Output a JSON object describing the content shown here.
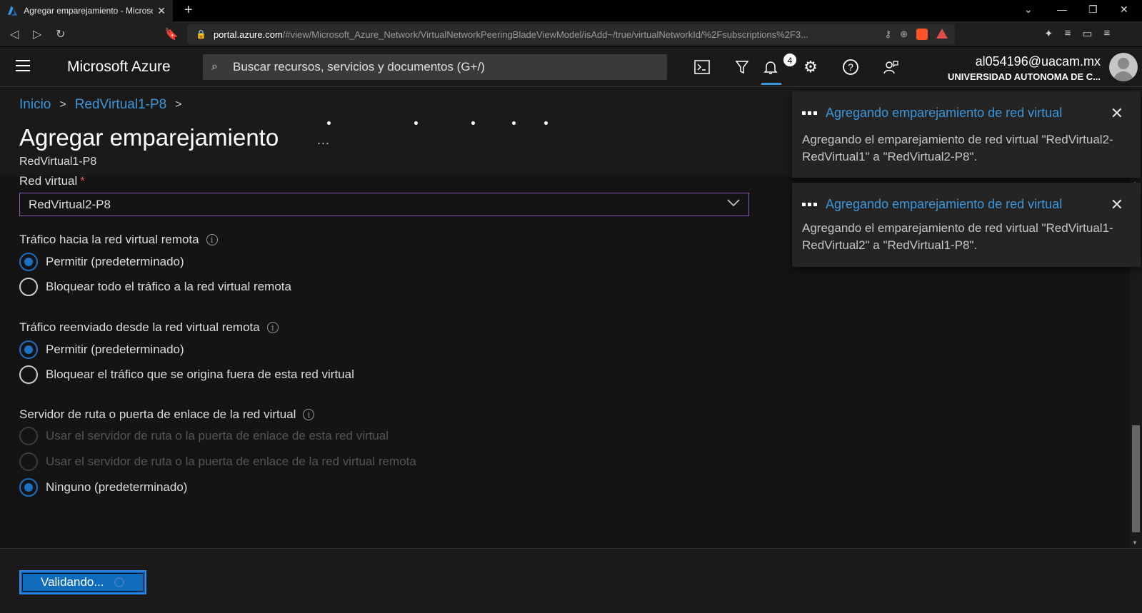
{
  "browser": {
    "tab_title": "Agregar emparejamiento - Microsoft Azure",
    "url_host": "portal.azure.com",
    "url_path": "/#view/Microsoft_Azure_Network/VirtualNetworkPeeringBladeViewModel/isAdd~/true/virtualNetworkId/%2Fsubscriptions%2F3..."
  },
  "header": {
    "brand": "Microsoft Azure",
    "search_placeholder": "Buscar recursos, servicios y documentos (G+/)",
    "notification_count": "4",
    "user_email": "al054196@uacam.mx",
    "user_org": "UNIVERSIDAD AUTONOMA DE C..."
  },
  "breadcrumb": {
    "items": [
      "Inicio",
      "RedVirtual1-P8"
    ]
  },
  "page": {
    "title": "Agregar emparejamiento",
    "subtitle": "RedVirtual1-P8",
    "more": "..."
  },
  "form": {
    "vnet_label": "Red virtual",
    "vnet_required": "*",
    "vnet_value": "RedVirtual2-P8",
    "section1": {
      "label": "Tráfico hacia la red virtual remota",
      "options": [
        "Permitir (predeterminado)",
        "Bloquear todo el tráfico a la red virtual remota"
      ],
      "selected": 0
    },
    "section2": {
      "label": "Tráfico reenviado desde la red virtual remota",
      "options": [
        "Permitir (predeterminado)",
        "Bloquear el tráfico que se origina fuera de esta red virtual"
      ],
      "selected": 0
    },
    "section3": {
      "label": "Servidor de ruta o puerta de enlace de la red virtual",
      "options": [
        "Usar el servidor de ruta o la puerta de enlace de esta red virtual",
        "Usar el servidor de ruta o la puerta de enlace de la red virtual remota",
        "Ninguno (predeterminado)"
      ],
      "selected": 2
    }
  },
  "footer": {
    "validate_label": "Validando..."
  },
  "toasts": [
    {
      "title": "Agregando emparejamiento de red virtual",
      "body": "Agregando el emparejamiento de red virtual \"RedVirtual2-RedVirtual1\" a \"RedVirtual2-P8\"."
    },
    {
      "title": "Agregando emparejamiento de red virtual",
      "body": "Agregando el emparejamiento de red virtual \"RedVirtual1-RedVirtual2\" a \"RedVirtual1-P8\"."
    }
  ],
  "colors": {
    "accent": "#3a96dd",
    "radio_checked": "#1e6fbf",
    "button": "#0f6cbd",
    "select_border": "#8e5bb7"
  }
}
